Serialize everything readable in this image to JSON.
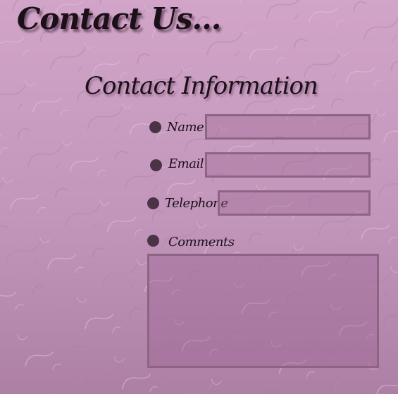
{
  "page": {
    "title": "Contact Us..."
  },
  "form": {
    "heading": "Contact Information",
    "fields": [
      {
        "label": "Name",
        "value": "",
        "placeholder": ""
      },
      {
        "label": "Email",
        "value": "",
        "placeholder": ""
      },
      {
        "label": "Telephone",
        "value": "",
        "placeholder": ""
      },
      {
        "label": "Comments",
        "value": "",
        "placeholder": ""
      }
    ]
  },
  "theme": {
    "background_top": "#d1a4c8",
    "background_bottom": "#ad7fa5",
    "text": "#1b1018",
    "bullet": "#4a3345",
    "field_border": "#8d6485"
  }
}
